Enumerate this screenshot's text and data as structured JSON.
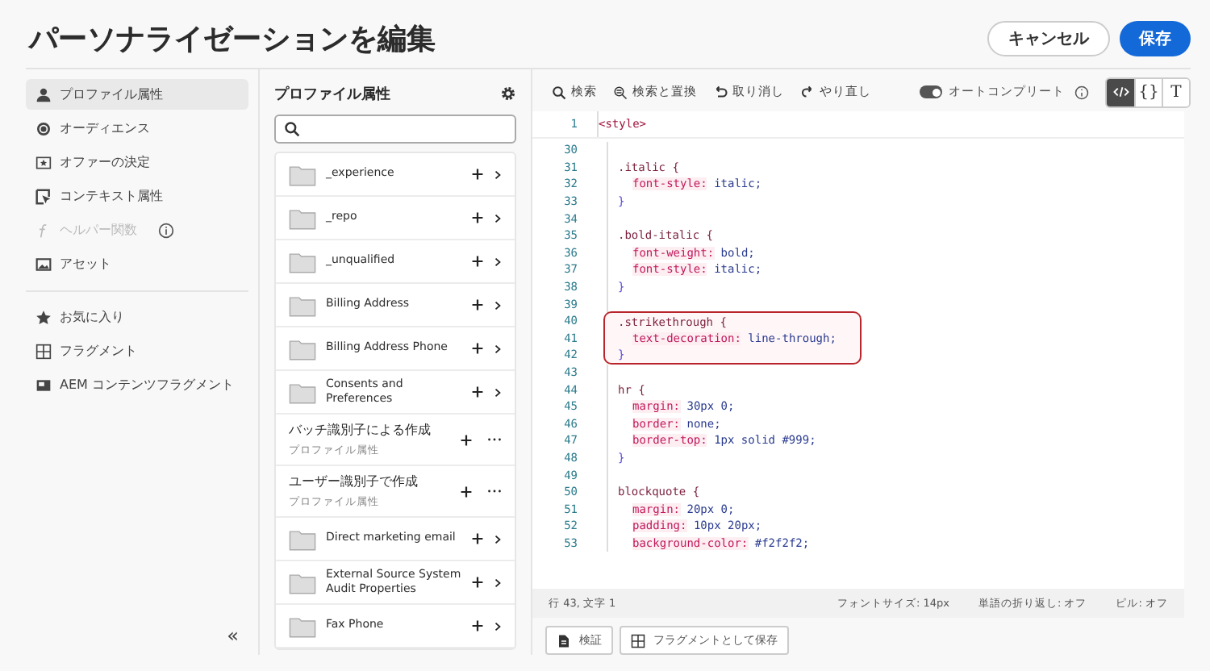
{
  "header": {
    "title": "パーソナライゼーションを編集",
    "buttons": [
      {
        "label": "キャンセル",
        "kind": "secondary"
      },
      {
        "label": "保存",
        "kind": "primary"
      }
    ]
  },
  "nav": {
    "items": [
      {
        "kind": "person",
        "label": "プロファイル属性",
        "selected": true,
        "disabled": false
      },
      {
        "kind": "audience",
        "label": "オーディエンス",
        "selected": false,
        "disabled": false
      },
      {
        "kind": "offer",
        "label": "オファーの決定",
        "selected": false,
        "disabled": false
      },
      {
        "kind": "context",
        "label": "コンテキスト属性",
        "selected": false,
        "disabled": false
      },
      {
        "kind": "helper",
        "label": "ヘルパー関数",
        "selected": false,
        "disabled": true,
        "info": true
      },
      {
        "kind": "image",
        "label": "アセット",
        "selected": false,
        "disabled": false
      }
    ],
    "secondary_items": [
      {
        "kind": "star",
        "label": "お気に入り",
        "selected": false,
        "disabled": false
      },
      {
        "kind": "fragment",
        "label": "フラグメント",
        "selected": false,
        "disabled": false
      },
      {
        "kind": "aem",
        "label": "AEM コンテンツフラグメント",
        "selected": false,
        "disabled": false
      }
    ],
    "collapse": "«"
  },
  "attributes": {
    "title": "プロファイル属性",
    "items": [
      {
        "kind": "folder",
        "label": "_experience"
      },
      {
        "kind": "folder",
        "label": "_repo"
      },
      {
        "kind": "folder",
        "label": "_unqualified"
      },
      {
        "kind": "folder",
        "label": "Billing Address"
      },
      {
        "kind": "folder",
        "label": "Billing Address Phone"
      },
      {
        "kind": "folder",
        "label": "Consents and Preferences"
      },
      {
        "kind": "field",
        "label": "バッチ識別子による作成",
        "subtitle": "プロファイル属性"
      },
      {
        "kind": "field",
        "label": "ユーザー識別子で作成",
        "subtitle": "プロファイル属性"
      },
      {
        "kind": "folder",
        "label": "Direct marketing email"
      },
      {
        "kind": "folder",
        "label": "External Source System Audit Properties"
      },
      {
        "kind": "folder",
        "label": "Fax Phone"
      }
    ]
  },
  "toolbar": {
    "actions": [
      {
        "kind": "search",
        "label": "検索"
      },
      {
        "kind": "replace",
        "label": "検索と置換"
      },
      {
        "kind": "undo",
        "label": "取り消し"
      },
      {
        "kind": "redo",
        "label": "やり直し"
      }
    ],
    "autocomplete": {
      "label": "オートコンプリート",
      "on": true
    },
    "modes": [
      {
        "kind": "code",
        "selected": true
      },
      {
        "kind": "text",
        "label": "{}",
        "selected": false
      },
      {
        "kind": "text",
        "label": "T",
        "selected": false
      }
    ]
  },
  "code": {
    "lines": [
      {
        "number": "1",
        "kind": "tag",
        "text": "<style>",
        "highlighted": false
      },
      {
        "number": "30",
        "kind": "blank",
        "highlighted": false
      },
      {
        "number": "31",
        "kind": "selector",
        "text": ".italic {",
        "highlighted": false
      },
      {
        "number": "32",
        "kind": "decl",
        "property": "font-style:",
        "value": "italic;",
        "highlighted": false
      },
      {
        "number": "33",
        "kind": "close",
        "text": "}",
        "highlighted": false
      },
      {
        "number": "34",
        "kind": "blank",
        "highlighted": false
      },
      {
        "number": "35",
        "kind": "selector",
        "text": ".bold-italic {",
        "highlighted": false
      },
      {
        "number": "36",
        "kind": "decl",
        "property": "font-weight:",
        "value": "bold;",
        "highlighted": false
      },
      {
        "number": "37",
        "kind": "decl",
        "property": "font-style:",
        "value": "italic;",
        "highlighted": false
      },
      {
        "number": "38",
        "kind": "close",
        "text": "}",
        "highlighted": false
      },
      {
        "number": "39",
        "kind": "blank",
        "highlighted": false
      },
      {
        "number": "40",
        "kind": "selector",
        "text": ".strikethrough {",
        "highlighted": true
      },
      {
        "number": "41",
        "kind": "decl",
        "property": "text-decoration:",
        "value": "line-through;",
        "highlighted": true
      },
      {
        "number": "42",
        "kind": "close",
        "text": "}",
        "highlighted": true
      },
      {
        "number": "43",
        "kind": "blank",
        "highlighted": false
      },
      {
        "number": "44",
        "kind": "selector",
        "text": "hr {",
        "highlighted": false
      },
      {
        "number": "45",
        "kind": "decl",
        "property": "margin:",
        "value": "30px 0;",
        "highlighted": false
      },
      {
        "number": "46",
        "kind": "decl",
        "property": "border:",
        "value": "none;",
        "highlighted": false
      },
      {
        "number": "47",
        "kind": "decl",
        "property": "border-top:",
        "value": "1px solid #999;",
        "highlighted": false
      },
      {
        "number": "48",
        "kind": "close",
        "text": "}",
        "highlighted": false
      },
      {
        "number": "49",
        "kind": "blank",
        "highlighted": false
      },
      {
        "number": "50",
        "kind": "selector",
        "text": "blockquote {",
        "highlighted": false
      },
      {
        "number": "51",
        "kind": "decl",
        "property": "margin:",
        "value": "20px 0;",
        "highlighted": false
      },
      {
        "number": "52",
        "kind": "decl",
        "property": "padding:",
        "value": "10px 20px;",
        "highlighted": false
      },
      {
        "number": "53",
        "kind": "decl",
        "property": "background-color:",
        "value": "#f2f2f2;",
        "highlighted": false
      }
    ]
  },
  "status_bar": {
    "position": "行 43, 文字 1",
    "font_size": "フォントサイズ: 14px",
    "word_wrap": "単語の折り返し: オフ",
    "pill": "ピル: オフ"
  },
  "footer_buttons": [
    {
      "kind": "validate",
      "label": "検証"
    },
    {
      "kind": "fragment",
      "label": "フラグメントとして保存"
    }
  ]
}
